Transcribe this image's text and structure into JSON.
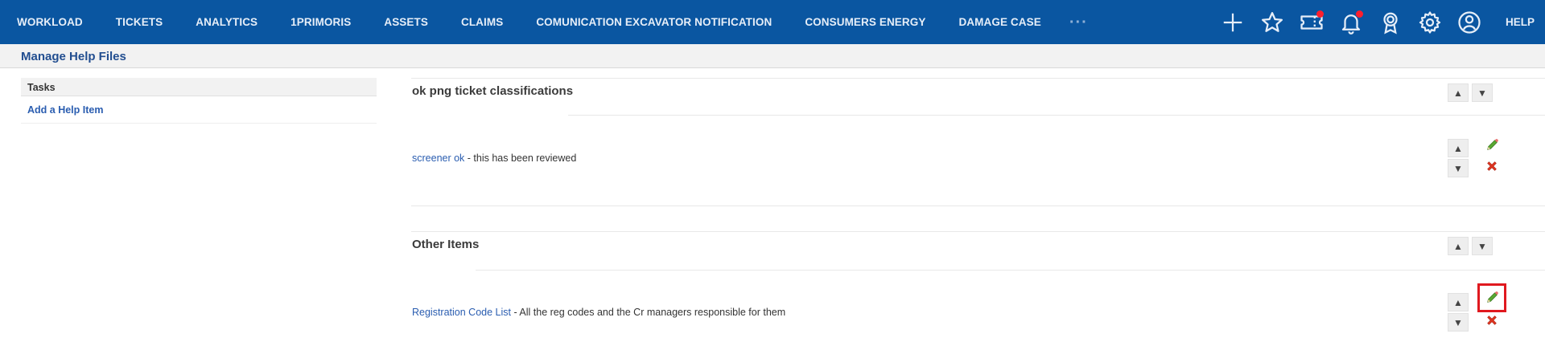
{
  "nav": {
    "items": [
      "WORKLOAD",
      "TICKETS",
      "ANALYTICS",
      "1PRIMORIS",
      "ASSETS",
      "CLAIMS",
      "COMUNICATION EXCAVATOR NOTIFICATION",
      "CONSUMERS ENERGY",
      "DAMAGE CASE"
    ],
    "more": "···",
    "icons": [
      "plus-icon",
      "star-icon",
      "ticket-icon",
      "bell-icon",
      "award-icon",
      "gear-icon",
      "user-icon"
    ],
    "help": "HELP",
    "accent": "#0a56a1",
    "badge_color": "#ff1f2d"
  },
  "page": {
    "title": "Manage Help Files"
  },
  "tasks": {
    "header": "Tasks",
    "link": "Add a Help Item"
  },
  "sections": [
    {
      "title": "ok png ticket classifications",
      "items": [
        {
          "link": "screener ok",
          "description": " - this has been reviewed"
        }
      ]
    },
    {
      "title": "Other Items",
      "items": [
        {
          "link": "Registration Code List",
          "description": " - All the reg codes and the Cr managers responsible for them"
        }
      ]
    }
  ],
  "controls": {
    "up": "▲",
    "down": "▼"
  }
}
